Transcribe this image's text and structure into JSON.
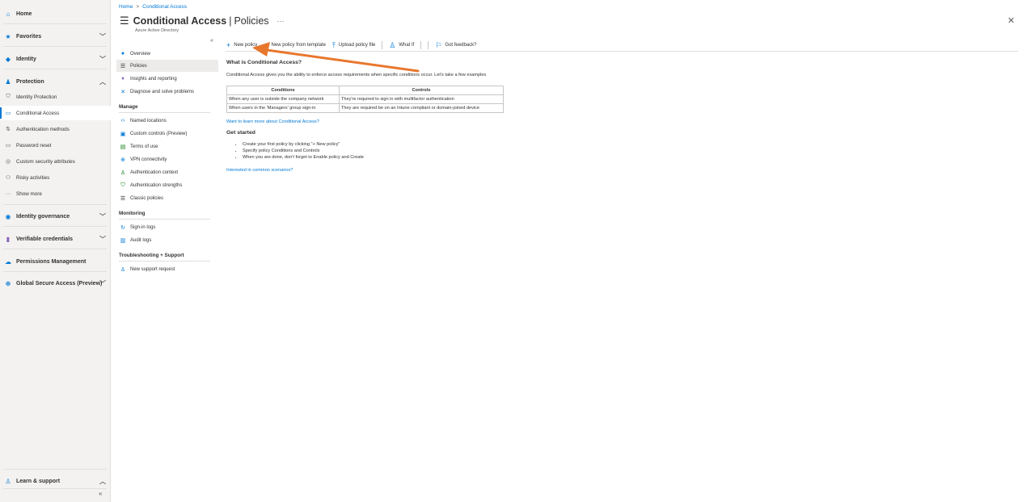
{
  "leftnav": {
    "items": [
      {
        "label": "Home",
        "icon": "home-icon",
        "glyph": "🏠︎",
        "color": "#0078d4"
      },
      {
        "label": "Favorites",
        "icon": "star-icon",
        "glyph": "★",
        "color": "#0078d4"
      },
      {
        "label": "Identity",
        "icon": "identity-icon",
        "glyph": "◆",
        "color": "#0078d4"
      },
      {
        "label": "Protection",
        "icon": "protection-icon",
        "glyph": "👥︎",
        "color": "#0078d4"
      }
    ],
    "protection_sub": [
      {
        "label": "Identity Protection",
        "icon": "shield-icon"
      },
      {
        "label": "Conditional Access",
        "icon": "conditional-access-icon"
      },
      {
        "label": "Authentication methods",
        "icon": "authentication-methods-icon"
      },
      {
        "label": "Password reset",
        "icon": "password-reset-icon"
      },
      {
        "label": "Custom security attributes",
        "icon": "custom-security-attributes-icon"
      },
      {
        "label": "Risky activities",
        "icon": "risky-activities-icon"
      },
      {
        "label": "Show more",
        "icon": "more-icon"
      }
    ],
    "lower_items": [
      {
        "label": "Identity governance"
      },
      {
        "label": "Verifiable credentials"
      },
      {
        "label": "Permissions Management"
      },
      {
        "label": "Global Secure Access (Preview)"
      }
    ],
    "learn_support": "Learn & support",
    "collapse": "«"
  },
  "breadcrumb": {
    "home": "Home",
    "sep": ">",
    "current": "Conditional Access"
  },
  "header": {
    "service": "Conditional Access",
    "separator": "|",
    "page": "Policies",
    "more": "···",
    "subtitle": "Azure Active Directory",
    "close": "✕"
  },
  "resource_menu": {
    "collapse": "«",
    "top_items": [
      "Overview",
      "Policies",
      "Insights and reporting",
      "Diagnose and solve problems"
    ],
    "manage_title": "Manage",
    "manage_items": [
      "Named locations",
      "Custom controls (Preview)",
      "Terms of use",
      "VPN connectivity",
      "Authentication context",
      "Authentication strengths",
      "Classic policies"
    ],
    "monitoring_title": "Monitoring",
    "monitoring_items": [
      "Sign-in logs",
      "Audit logs"
    ],
    "troubleshooting_title": "Troubleshooting + Support",
    "troubleshooting_items": [
      "New support request"
    ]
  },
  "commands": {
    "new_policy": "New policy",
    "new_from_template": "New policy from template",
    "upload": "Upload policy file",
    "what_if": "What If",
    "feedback": "Got feedback?"
  },
  "content": {
    "heading": "What is Conditional Access?",
    "intro": "Conditional Access gives you the ability to enforce access requirements when specific conditions occur. Let's take a few examples",
    "table": {
      "headers": [
        "Conditions",
        "Controls"
      ],
      "rows": [
        [
          "When any user is outside the company network",
          "They're required to sign in with multifactor authentication"
        ],
        [
          "When users in the 'Managers' group sign-in",
          "They are required be on an Intune compliant or domain-joined device"
        ]
      ]
    },
    "learn_link": "Want to learn more about Conditional Access?",
    "get_started": "Get started",
    "steps": [
      "Create your first policy by clicking \"+ New policy\"",
      "Specify policy Conditions and Controls",
      "When you are done, don't forget to Enable policy and Create"
    ],
    "scenarios_link": "Interested in common scenarios?"
  },
  "colors": {
    "accent": "#0078d4",
    "arrow": "#e8772e"
  }
}
